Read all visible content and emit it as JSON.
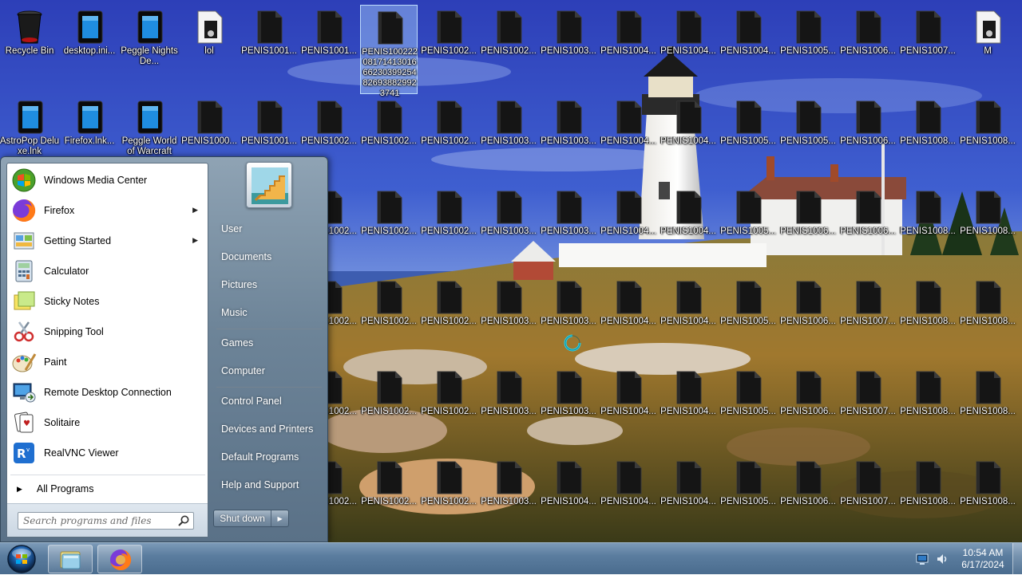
{
  "desktop": {
    "icons": [
      [
        "Recycle Bin",
        "desktop.ini...",
        "Peggle Nights De...",
        "lol",
        "PENIS1001...",
        "PENIS1001...",
        "PENIS100222 08171413016 66230399254 82693882992 3741",
        "PENIS1002...",
        "PENIS1002...",
        "PENIS1003...",
        "PENIS1004...",
        "PENIS1004...",
        "PENIS1004...",
        "PENIS1005...",
        "PENIS1006...",
        "PENIS1007...",
        "M"
      ],
      [
        "AstroPop Deluxe.lnk",
        "Firefox.lnk...",
        "Peggle World of Warcraft",
        "PENIS1000...",
        "PENIS1001...",
        "PENIS1002...",
        "PENIS1002...",
        "PENIS1002...",
        "PENIS1003...",
        "PENIS1003...",
        "PENIS1004...",
        "PENIS1004...",
        "PENIS1005...",
        "PENIS1005...",
        "PENIS1006...",
        "PENIS1008...",
        "PENIS1008..."
      ],
      [
        "",
        "",
        "",
        "",
        "",
        "PENIS1002...",
        "PENIS1002...",
        "PENIS1002...",
        "PENIS1003...",
        "PENIS1003...",
        "PENIS1004...",
        "PENIS1004...",
        "PENIS1005...",
        "PENIS1006...",
        "PENIS1006...",
        "PENIS1008...",
        "PENIS1008..."
      ],
      [
        "",
        "",
        "",
        "",
        "",
        "PENIS1002...",
        "PENIS1002...",
        "PENIS1002...",
        "PENIS1003...",
        "PENIS1003...",
        "PENIS1004...",
        "PENIS1004...",
        "PENIS1005...",
        "PENIS1006...",
        "PENIS1007...",
        "PENIS1008...",
        "PENIS1008..."
      ],
      [
        "",
        "",
        "",
        "",
        "",
        "PENIS1002...",
        "PENIS1002...",
        "PENIS1002...",
        "PENIS1003...",
        "PENIS1003...",
        "PENIS1004...",
        "PENIS1004...",
        "PENIS1005...",
        "PENIS1006...",
        "PENIS1007...",
        "PENIS1008...",
        "PENIS1008..."
      ],
      [
        "",
        "",
        "",
        "",
        "",
        "PENIS1002...",
        "PENIS1002...",
        "PENIS1002...",
        "PENIS1003...",
        "PENIS1004...",
        "PENIS1004...",
        "PENIS1004...",
        "PENIS1005...",
        "PENIS1006...",
        "PENIS1007...",
        "PENIS1008...",
        "PENIS1008..."
      ]
    ],
    "selected_icon": "PENIS100222 08171413016 66230399254 82693882992 3741"
  },
  "start_menu": {
    "programs": [
      {
        "label": "Windows Media Center",
        "icon": "windows-media-center-icon",
        "submenu": false
      },
      {
        "label": "Firefox",
        "icon": "firefox-icon",
        "submenu": true
      },
      {
        "label": "Getting Started",
        "icon": "getting-started-icon",
        "submenu": true
      },
      {
        "label": "Calculator",
        "icon": "calculator-icon",
        "submenu": false
      },
      {
        "label": "Sticky Notes",
        "icon": "sticky-notes-icon",
        "submenu": false
      },
      {
        "label": "Snipping Tool",
        "icon": "snipping-tool-icon",
        "submenu": false
      },
      {
        "label": "Paint",
        "icon": "paint-icon",
        "submenu": false
      },
      {
        "label": "Remote Desktop Connection",
        "icon": "remote-desktop-icon",
        "submenu": false
      },
      {
        "label": "Solitaire",
        "icon": "solitaire-icon",
        "submenu": false
      },
      {
        "label": "RealVNC Viewer",
        "icon": "realvnc-icon",
        "submenu": false
      }
    ],
    "all_programs": "All Programs",
    "search_placeholder": "Search programs and files",
    "right_links": [
      "User",
      "Documents",
      "Pictures",
      "Music",
      "Games",
      "Computer",
      "Control Panel",
      "Devices and Printers",
      "Default Programs",
      "Help and Support"
    ],
    "shutdown_label": "Shut down"
  },
  "taskbar": {
    "time": "10:54 AM",
    "date": "6/17/2024",
    "pinned": [
      "explorer-icon",
      "firefox-icon"
    ]
  },
  "colors": {
    "taskbar": "#5b7d9f",
    "start_menu_right": "#6d8498",
    "selection": "#aad2ff"
  }
}
